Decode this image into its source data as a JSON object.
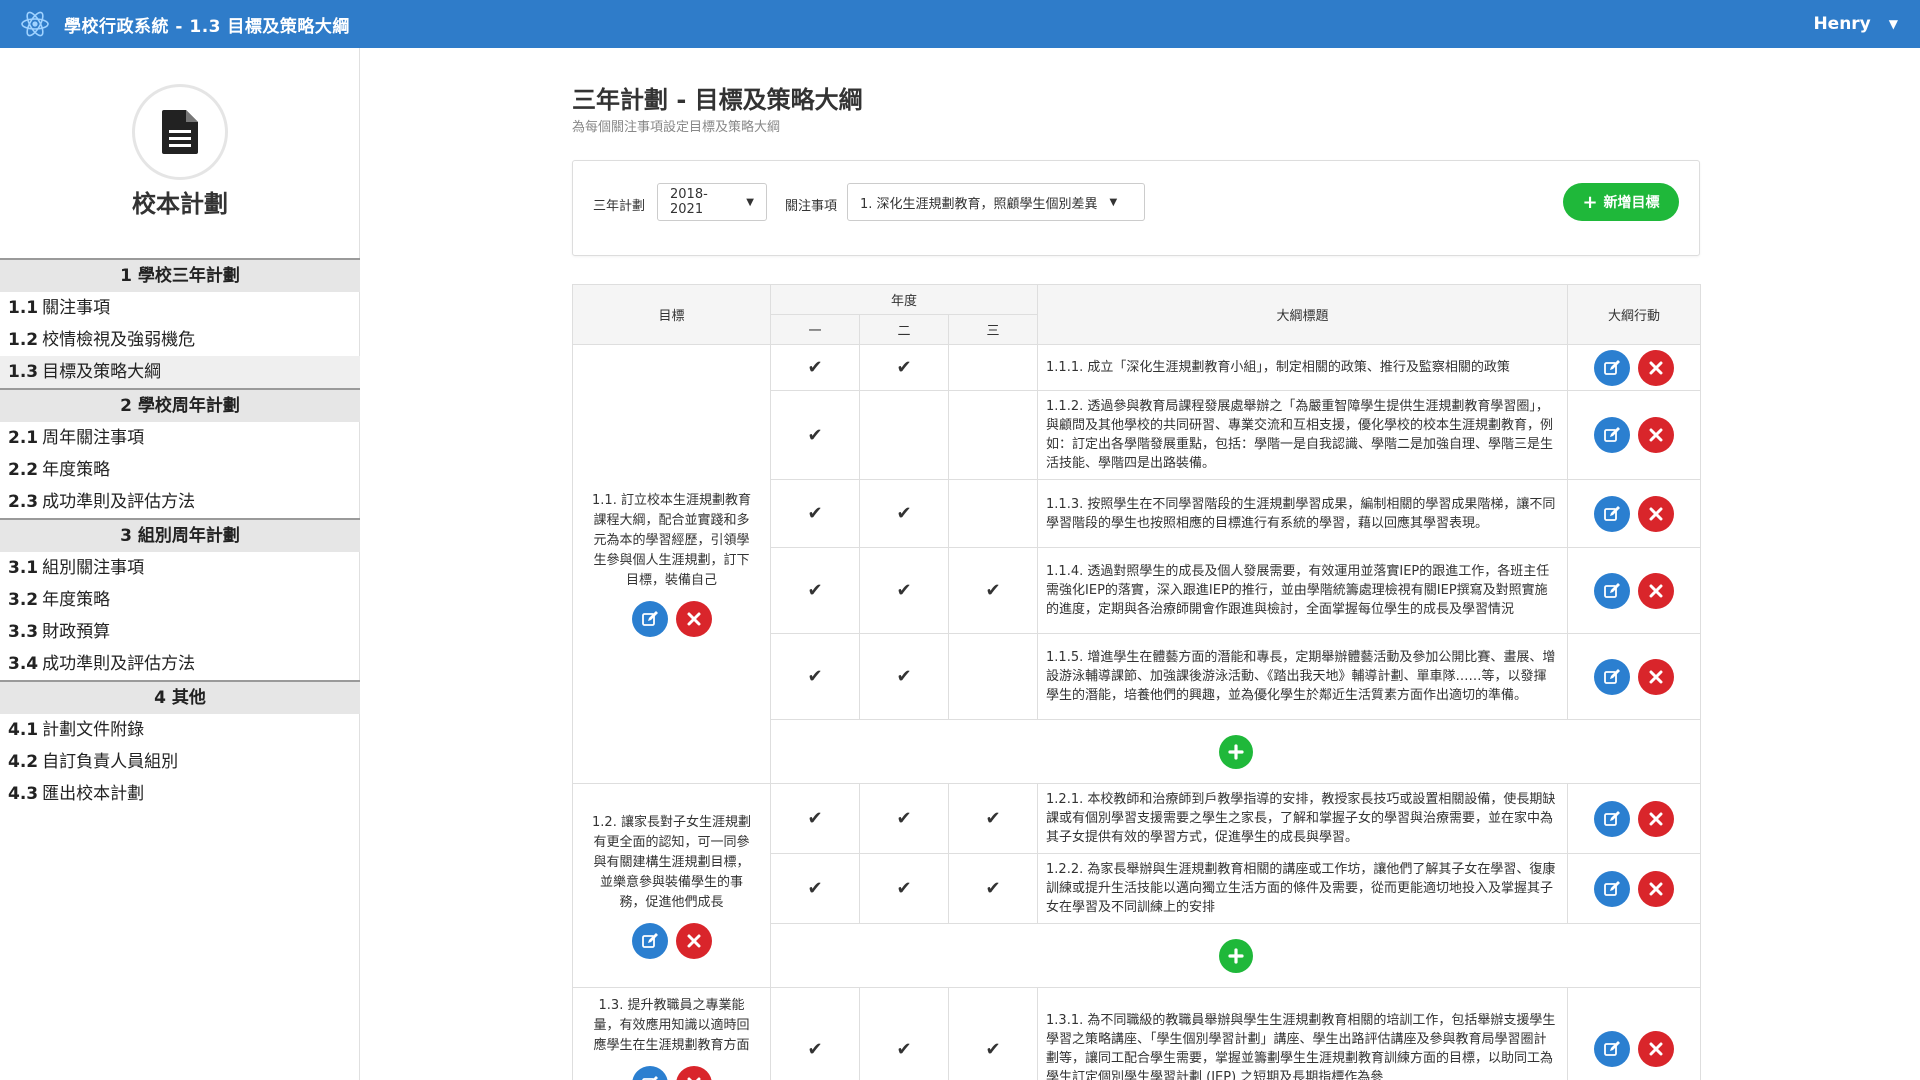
{
  "app": {
    "title": "學校行政系統 - 1.3 目標及策略大綱",
    "user": "Henry"
  },
  "sidebar": {
    "brand": "校本計劃",
    "sections": [
      {
        "title": "1 學校三年計劃",
        "items": [
          {
            "num": "1.1",
            "label": "關注事項"
          },
          {
            "num": "1.2",
            "label": "校情檢視及強弱機危"
          },
          {
            "num": "1.3",
            "label": "目標及策略大綱"
          }
        ]
      },
      {
        "title": "2 學校周年計劃",
        "items": [
          {
            "num": "2.1",
            "label": "周年關注事項"
          },
          {
            "num": "2.2",
            "label": "年度策略"
          },
          {
            "num": "2.3",
            "label": "成功準則及評估方法"
          }
        ]
      },
      {
        "title": "3 組別周年計劃",
        "items": [
          {
            "num": "3.1",
            "label": "組別關注事項"
          },
          {
            "num": "3.2",
            "label": "年度策略"
          },
          {
            "num": "3.3",
            "label": "財政預算"
          },
          {
            "num": "3.4",
            "label": "成功準則及評估方法"
          }
        ]
      },
      {
        "title": "4 其他",
        "items": [
          {
            "num": "4.1",
            "label": "計劃文件附錄"
          },
          {
            "num": "4.2",
            "label": "自訂負責人員組別"
          },
          {
            "num": "4.3",
            "label": "匯出校本計劃"
          }
        ]
      }
    ]
  },
  "page": {
    "title": "三年計劃 - 目標及策略大綱",
    "subtitle": "為每個關注事項設定目標及策略大綱"
  },
  "filters": {
    "plan_label": "三年計劃",
    "plan_value": "2018-2021",
    "focus_label": "關注事項",
    "focus_value": "1. 深化生涯規劃教育，照顧學生個別差異",
    "add_goal": "新增目標"
  },
  "table": {
    "headers": {
      "goal": "目標",
      "year": "年度",
      "y1": "一",
      "y2": "二",
      "y3": "三",
      "outline": "大綱標題",
      "actions": "大綱行動"
    },
    "check_mark": "✔"
  },
  "goals": [
    {
      "text": "1.1. 訂立校本生涯規劃教育課程大綱，配合並實踐和多元為本的學習經歷，引領學生參與個人生涯規劃，訂下目標，裝備自己",
      "rows": [
        {
          "y1": true,
          "y2": true,
          "y3": false,
          "text": "1.1.1. 成立「深化生涯規劃教育小組」，制定相關的政策、推行及監察相關的政策"
        },
        {
          "y1": true,
          "y2": false,
          "y3": false,
          "text": "1.1.2. 透過參與教育局課程發展處舉辦之「為嚴重智障學生提供生涯規劃教育學習圈」，與顧問及其他學校的共同研習、專業交流和互相支援，優化學校的校本生涯規劃教育，例如：訂定出各學階發展重點，包括：學階一是自我認識、學階二是加強自理、學階三是生活技能、學階四是出路裝備。"
        },
        {
          "y1": true,
          "y2": true,
          "y3": false,
          "text": "1.1.3. 按照學生在不同學習階段的生涯規劃學習成果，編制相關的學習成果階梯，讓不同學習階段的學生也按照相應的目標進行有系統的學習，藉以回應其學習表現。"
        },
        {
          "y1": true,
          "y2": true,
          "y3": true,
          "text": "1.1.4. 透過對照學生的成長及個人發展需要，有效運用並落實IEP的跟進工作，各班主任需強化IEP的落實，深入跟進IEP的推行，並由學階統籌處理檢視有關IEP撰寫及對照實施的進度，定期與各治療師開會作跟進與檢討，全面掌握每位學生的成長及學習情況"
        },
        {
          "y1": true,
          "y2": true,
          "y3": false,
          "text": "1.1.5. 增進學生在體藝方面的潛能和專長，定期舉辦體藝活動及參加公開比賽、畫展、增設游泳輔導課節、加強課後游泳活動、《踏出我天地》輔導計劃、單車隊……等，以發揮學生的潛能，培養他們的興趣，並為優化學生於鄰近生活質素方面作出適切的準備。"
        }
      ]
    },
    {
      "text": "1.2. 讓家長對子女生涯規劃有更全面的認知，可一同參與有關建構生涯規劃目標，並樂意參與裝備學生的事務，促進他們成長",
      "rows": [
        {
          "y1": true,
          "y2": true,
          "y3": true,
          "text": "1.2.1. 本校教師和治療師到戶教學指導的安排，教授家長技巧或設置相關設備，使長期缺課或有個別學習支援需要之學生之家長，了解和掌握子女的學習與治療需要，並在家中為其子女提供有效的學習方式，促進學生的成長與學習。"
        },
        {
          "y1": true,
          "y2": true,
          "y3": true,
          "text": "1.2.2. 為家長舉辦與生涯規劃教育相關的講座或工作坊，讓他們了解其子女在學習、復康訓練或提升生活技能以邁向獨立生活方面的條件及需要，從而更能適切地投入及掌握其子女在學習及不同訓練上的安排"
        }
      ]
    },
    {
      "text": "1.3. 提升教職員之專業能量，有效應用知識以適時回應學生在生涯規劃教育方面",
      "rows": [
        {
          "y1": true,
          "y2": true,
          "y3": true,
          "text": "1.3.1. 為不同職級的教職員舉辦與學生生涯規劃教育相關的培訓工作，包括舉辦支援學生學習之策略講座、「學生個別學習計劃」講座、學生出路評估講座及參與教育局學習圈計劃等，讓同工配合學生需要，掌握並籌劃學生生涯規劃教育訓練方面的目標，以助同工為學生訂定個別學生學習計劃 (IEP) 之短期及長期指標作為參"
        }
      ]
    }
  ]
}
